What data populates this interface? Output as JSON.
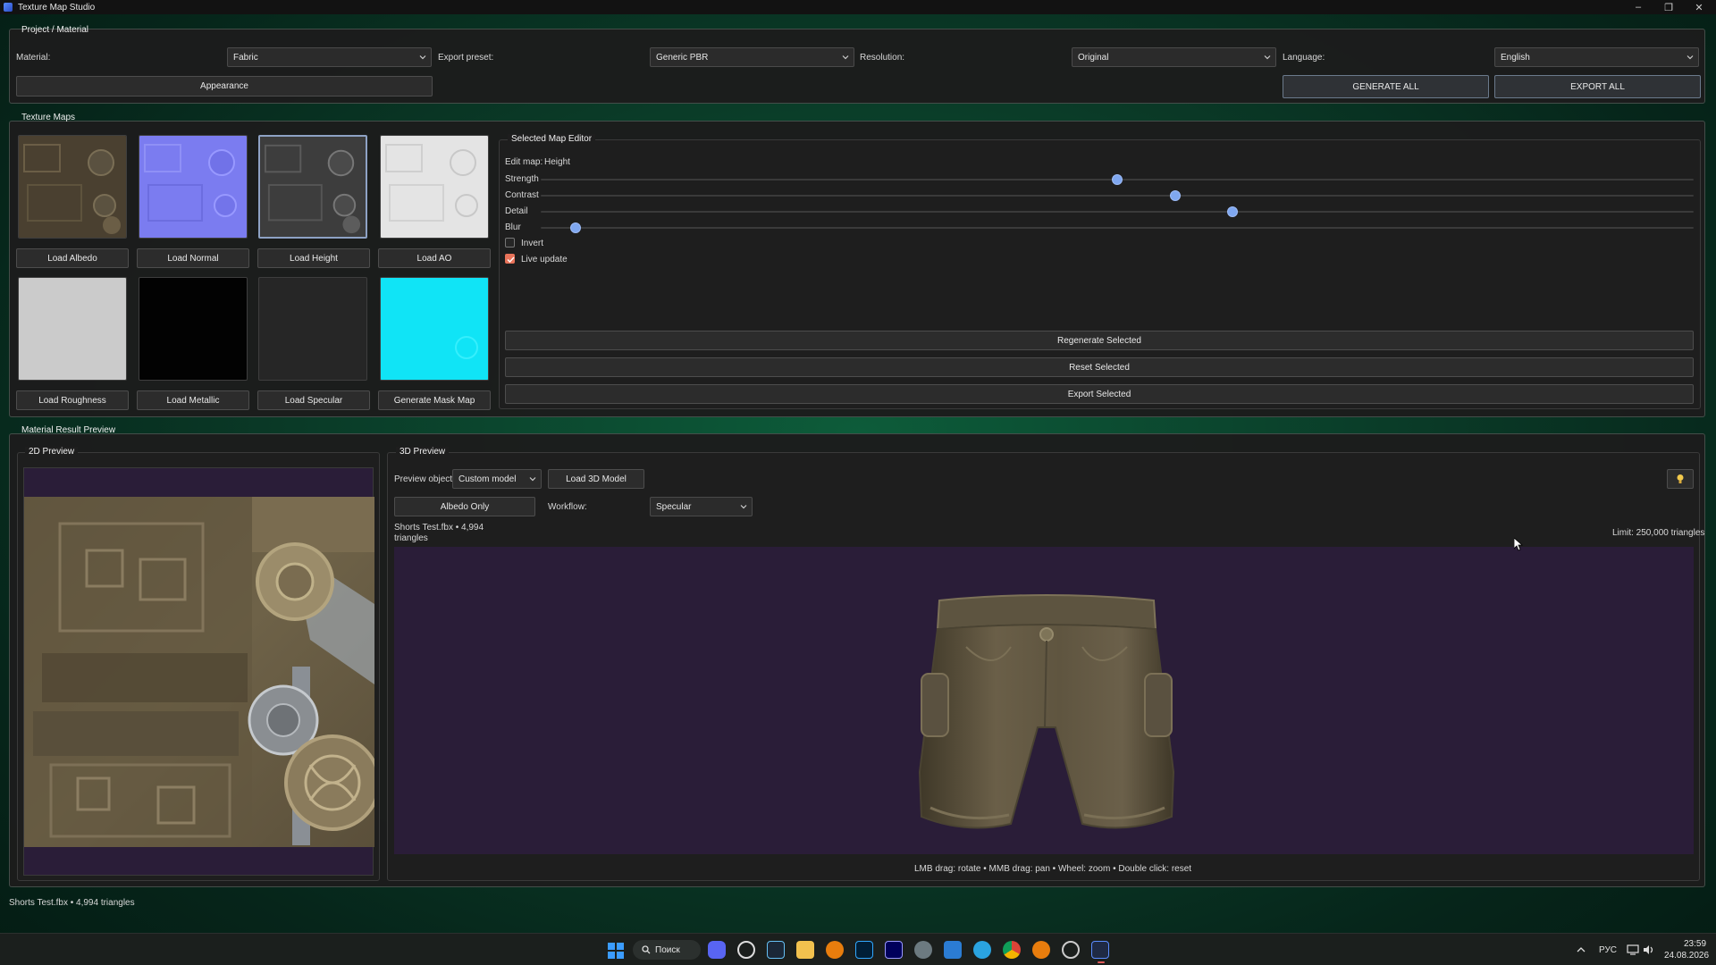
{
  "window": {
    "title": "Texture Map Studio"
  },
  "project": {
    "group_title": "Project / Material",
    "material_label": "Material:",
    "material_value": "Fabric",
    "export_preset_label": "Export preset:",
    "export_preset_value": "Generic PBR",
    "resolution_label": "Resolution:",
    "resolution_value": "Original",
    "language_label": "Language:",
    "language_value": "English",
    "appearance_button": "Appearance",
    "generate_all_button": "GENERATE ALL",
    "export_all_button": "EXPORT ALL"
  },
  "texture_maps": {
    "group_title": "Texture Maps",
    "buttons": [
      "Load Albedo",
      "Load Normal",
      "Load Height",
      "Load AO",
      "Load Roughness",
      "Load Metallic",
      "Load Specular",
      "Generate Mask Map"
    ],
    "selected_index": 2
  },
  "editor": {
    "group_title": "Selected Map Editor",
    "edit_map_label": "Edit map:",
    "edit_map_value": "Height",
    "sliders": [
      {
        "label": "Strength",
        "value": 0.5
      },
      {
        "label": "Contrast",
        "value": 0.55
      },
      {
        "label": "Detail",
        "value": 0.6
      },
      {
        "label": "Blur",
        "value": 0.03
      }
    ],
    "invert_label": "Invert",
    "invert_checked": false,
    "live_update_label": "Live update",
    "live_update_checked": true,
    "regenerate_button": "Regenerate Selected",
    "reset_button": "Reset Selected",
    "export_button": "Export Selected"
  },
  "preview": {
    "group_title": "Material Result Preview",
    "preview2d_title": "2D Preview",
    "preview3d_title": "3D Preview",
    "preview_object_label": "Preview object:",
    "preview_object_value": "Custom model",
    "load_model_button": "Load 3D Model",
    "albedo_only_button": "Albedo Only",
    "workflow_label": "Workflow:",
    "workflow_value": "Specular",
    "model_info_line1": "Shorts Test.fbx • 4,994",
    "model_info_line2": "triangles",
    "limit_text": "Limit: 250,000 triangles",
    "hint_text": "LMB drag: rotate  •  MMB drag: pan  •  Wheel: zoom  •  Double click: reset"
  },
  "status_bar": {
    "text": "Shorts Test.fbx • 4,994 triangles"
  },
  "taskbar": {
    "search_label": "Поиск",
    "lang_indicator": "РУС",
    "time": "23:59",
    "date": "24.08.2026"
  },
  "colors": {
    "accent": "#7fa7f0",
    "checkbox_on": "#e8735a",
    "viewport_bg": "#2a1d38"
  }
}
